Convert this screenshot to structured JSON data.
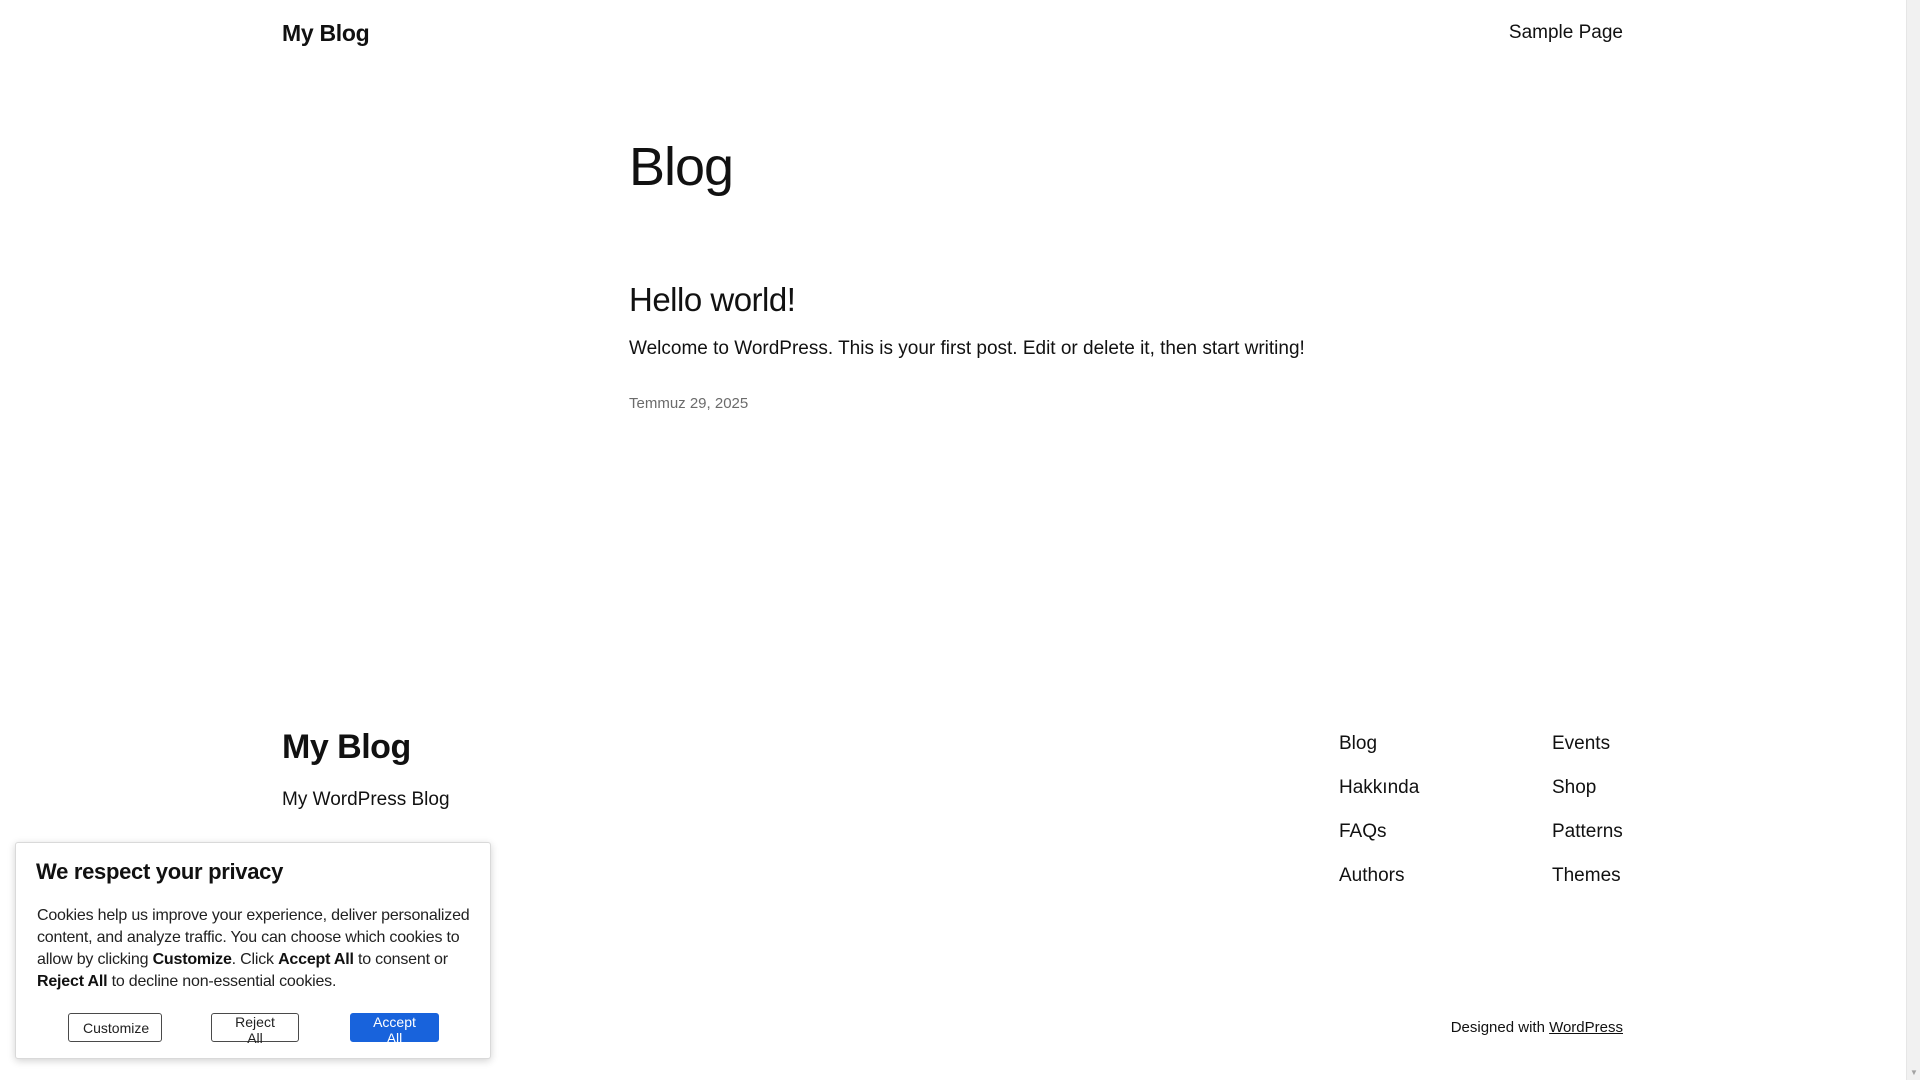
{
  "header": {
    "site_title": "My Blog",
    "nav": {
      "sample_page": "Sample Page"
    }
  },
  "main": {
    "heading": "Blog",
    "post": {
      "title": "Hello world!",
      "excerpt": "Welcome to WordPress. This is your first post. Edit or delete it, then start writing!",
      "date": "Temmuz 29, 2025"
    }
  },
  "footer": {
    "title": "My Blog",
    "tagline": "My WordPress Blog",
    "links_col_a": [
      "Blog",
      "Hakkında",
      "FAQs",
      "Authors"
    ],
    "links_col_b": [
      "Events",
      "Shop",
      "Patterns",
      "Themes"
    ],
    "designed_with_prefix": "Designed with ",
    "designed_with_link": "WordPress"
  },
  "cookie_banner": {
    "title": "We respect your privacy",
    "text_1": "Cookies help us improve your experience, deliver personalized content, and analyze traffic. You can choose which cookies to allow by clicking ",
    "bold_customize": "Customize",
    "text_2": ". Click ",
    "bold_accept": "Accept All",
    "text_3": " to consent or ",
    "bold_reject": "Reject All",
    "text_4": " to decline non-essential cookies.",
    "buttons": {
      "customize": "Customize",
      "reject": "Reject All",
      "accept": "Accept All"
    },
    "accent_color": "#1863dc"
  }
}
